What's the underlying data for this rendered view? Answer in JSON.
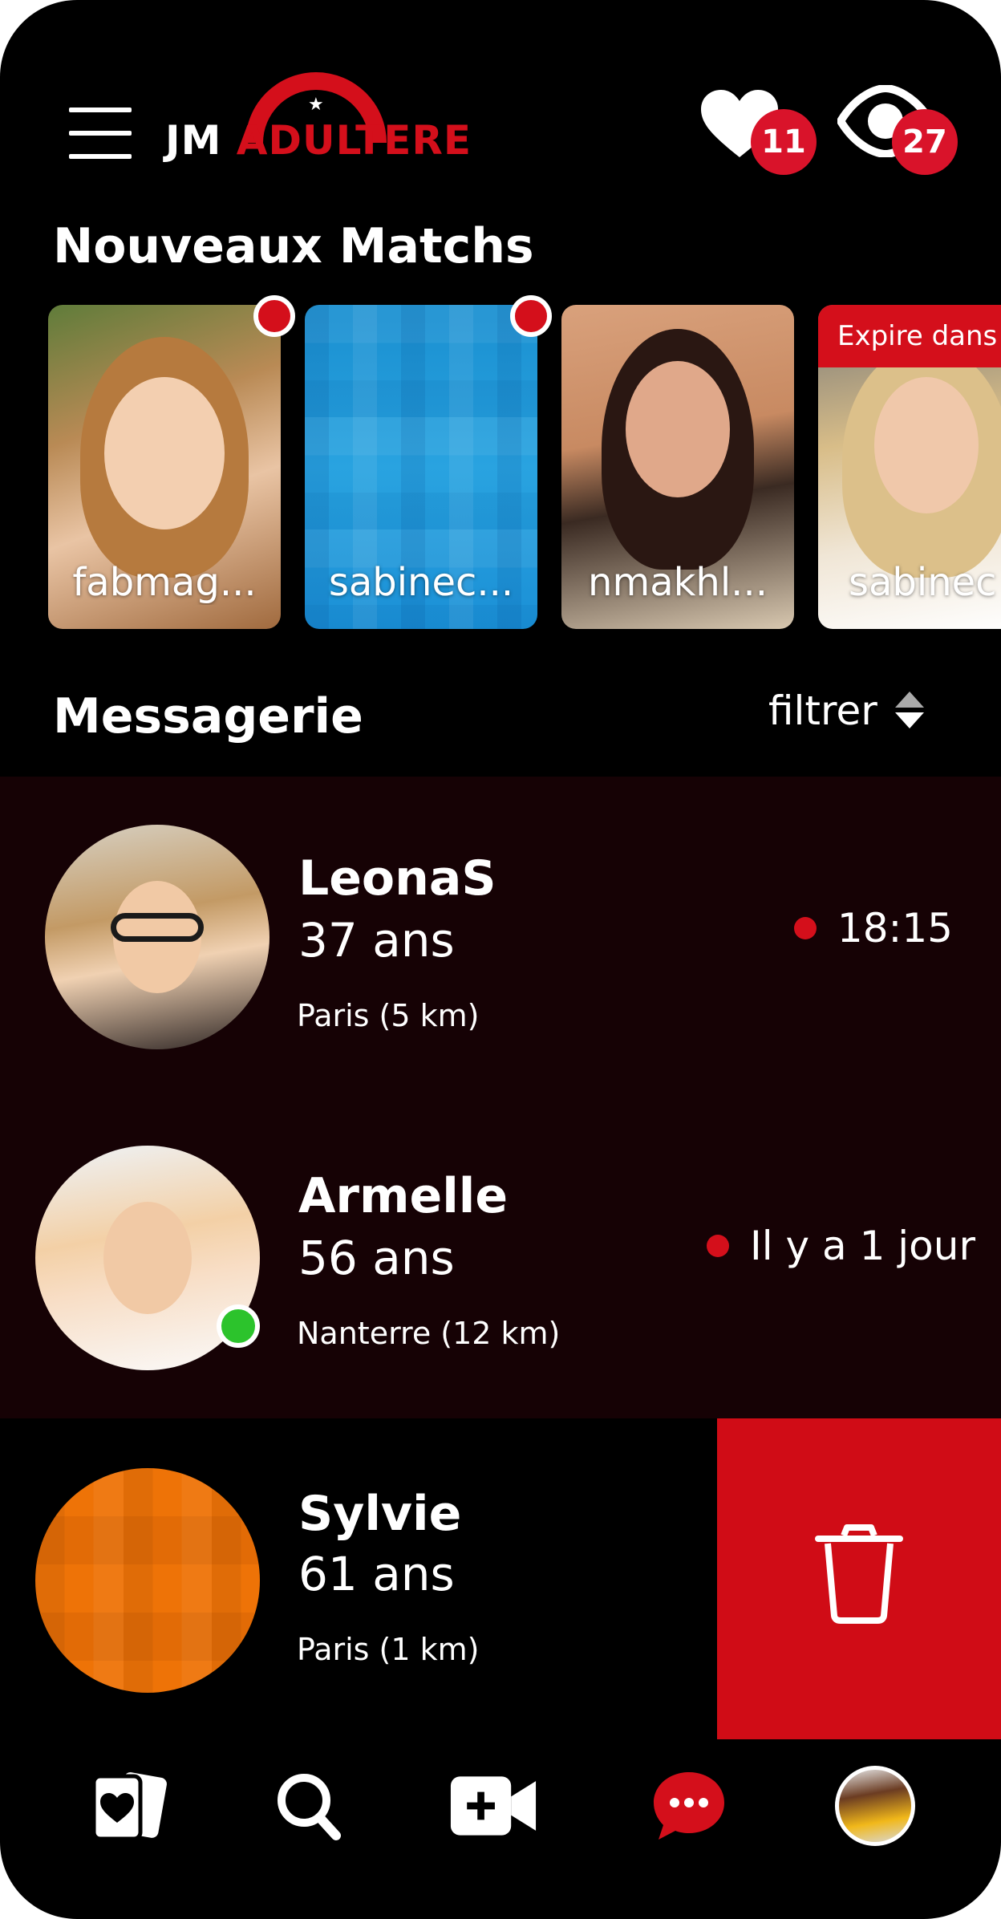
{
  "header": {
    "logo_prefix": "JM",
    "logo_brand": "ADULTERE",
    "likes_count": "11",
    "views_count": "27"
  },
  "matches": {
    "title": "Nouveaux Matchs",
    "items": [
      {
        "name": "fabmag...",
        "new": true
      },
      {
        "name": "sabinec...",
        "new": true
      },
      {
        "name": "nmakhl...",
        "new": false
      },
      {
        "name": "sabinec",
        "expire_label": "Expire dans"
      }
    ]
  },
  "messages": {
    "title": "Messagerie",
    "filter_label": "filtrer",
    "conversations": [
      {
        "name": "LeonaS",
        "age": "37 ans",
        "location": "Paris (5 km)",
        "time": "18:15",
        "unread": true,
        "online": false
      },
      {
        "name": "Armelle",
        "age": "56 ans",
        "location": "Nanterre (12 km)",
        "time": "Il y a 1 jour",
        "unread": true,
        "online": true
      },
      {
        "name": "Sylvie",
        "age": "61 ans",
        "location": "Paris (1 km)",
        "time": "",
        "unread": false,
        "online": false
      }
    ]
  },
  "bottom_nav": {
    "items": [
      "cards-icon",
      "search-icon",
      "video-call-icon",
      "chat-icon",
      "profile-avatar"
    ],
    "active": "chat-icon"
  },
  "colors": {
    "accent": "#d40f1b",
    "background": "#000000",
    "conversation_bg": "#160205",
    "online": "#2cc32c"
  }
}
